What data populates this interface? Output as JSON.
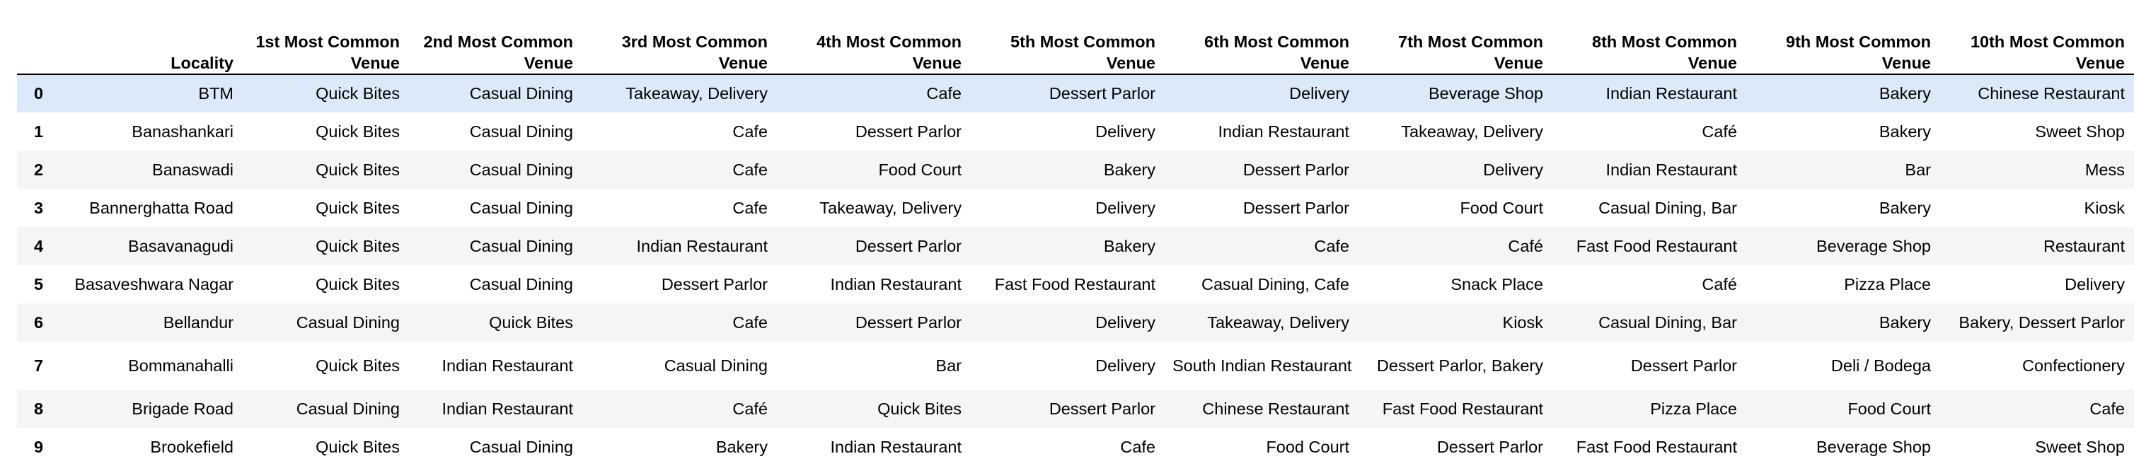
{
  "table": {
    "columns": [
      "",
      "Locality",
      "1st Most Common Venue",
      "2nd Most Common Venue",
      "3rd Most Common Venue",
      "4th Most Common Venue",
      "5th Most Common Venue",
      "6th Most Common Venue",
      "7th Most Common Venue",
      "8th Most Common Venue",
      "9th Most Common Venue",
      "10th Most Common Venue"
    ],
    "header_lines": [
      [
        "",
        ""
      ],
      [
        "",
        "Locality"
      ],
      [
        "1st Most Common",
        "Venue"
      ],
      [
        "2nd Most Common",
        "Venue"
      ],
      [
        "3rd Most Common",
        "Venue"
      ],
      [
        "4th Most Common",
        "Venue"
      ],
      [
        "5th Most Common",
        "Venue"
      ],
      [
        "6th Most Common",
        "Venue"
      ],
      [
        "7th Most Common",
        "Venue"
      ],
      [
        "8th Most Common",
        "Venue"
      ],
      [
        "9th Most Common",
        "Venue"
      ],
      [
        "10th Most Common",
        "Venue"
      ]
    ],
    "rows": [
      [
        "0",
        "BTM",
        "Quick Bites",
        "Casual Dining",
        "Takeaway, Delivery",
        "Cafe",
        "Dessert Parlor",
        "Delivery",
        "Beverage Shop",
        "Indian Restaurant",
        "Bakery",
        "Chinese Restaurant"
      ],
      [
        "1",
        "Banashankari",
        "Quick Bites",
        "Casual Dining",
        "Cafe",
        "Dessert Parlor",
        "Delivery",
        "Indian Restaurant",
        "Takeaway, Delivery",
        "Café",
        "Bakery",
        "Sweet Shop"
      ],
      [
        "2",
        "Banaswadi",
        "Quick Bites",
        "Casual Dining",
        "Cafe",
        "Food Court",
        "Bakery",
        "Dessert Parlor",
        "Delivery",
        "Indian Restaurant",
        "Bar",
        "Mess"
      ],
      [
        "3",
        "Bannerghatta Road",
        "Quick Bites",
        "Casual Dining",
        "Cafe",
        "Takeaway, Delivery",
        "Delivery",
        "Dessert Parlor",
        "Food Court",
        "Casual Dining, Bar",
        "Bakery",
        "Kiosk"
      ],
      [
        "4",
        "Basavanagudi",
        "Quick Bites",
        "Casual Dining",
        "Indian Restaurant",
        "Dessert Parlor",
        "Bakery",
        "Cafe",
        "Café",
        "Fast Food Restaurant",
        "Beverage Shop",
        "Restaurant"
      ],
      [
        "5",
        "Basaveshwara Nagar",
        "Quick Bites",
        "Casual Dining",
        "Dessert Parlor",
        "Indian Restaurant",
        "Fast Food Restaurant",
        "Casual Dining, Cafe",
        "Snack Place",
        "Café",
        "Pizza Place",
        "Delivery"
      ],
      [
        "6",
        "Bellandur",
        "Casual Dining",
        "Quick Bites",
        "Cafe",
        "Dessert Parlor",
        "Delivery",
        "Takeaway, Delivery",
        "Kiosk",
        "Casual Dining, Bar",
        "Bakery",
        "Bakery, Dessert Parlor"
      ],
      [
        "7",
        "Bommanahalli",
        "Quick Bites",
        "Indian Restaurant",
        "Casual Dining",
        "Bar",
        "Delivery",
        "South Indian Restaurant",
        "Dessert Parlor, Bakery",
        "Dessert Parlor",
        "Deli / Bodega",
        "Confectionery"
      ],
      [
        "8",
        "Brigade Road",
        "Casual Dining",
        "Indian Restaurant",
        "Café",
        "Quick Bites",
        "Dessert Parlor",
        "Chinese Restaurant",
        "Fast Food Restaurant",
        "Pizza Place",
        "Food Court",
        "Cafe"
      ],
      [
        "9",
        "Brookefield",
        "Quick Bites",
        "Casual Dining",
        "Bakery",
        "Indian Restaurant",
        "Cafe",
        "Food Court",
        "Dessert Parlor",
        "Fast Food Restaurant",
        "Beverage Shop",
        "Sweet Shop"
      ]
    ],
    "selected_row": 0,
    "colors": {
      "selected": "#dbe9f8",
      "stripe": "#f5f5f5",
      "header_rule": "#000000"
    }
  }
}
